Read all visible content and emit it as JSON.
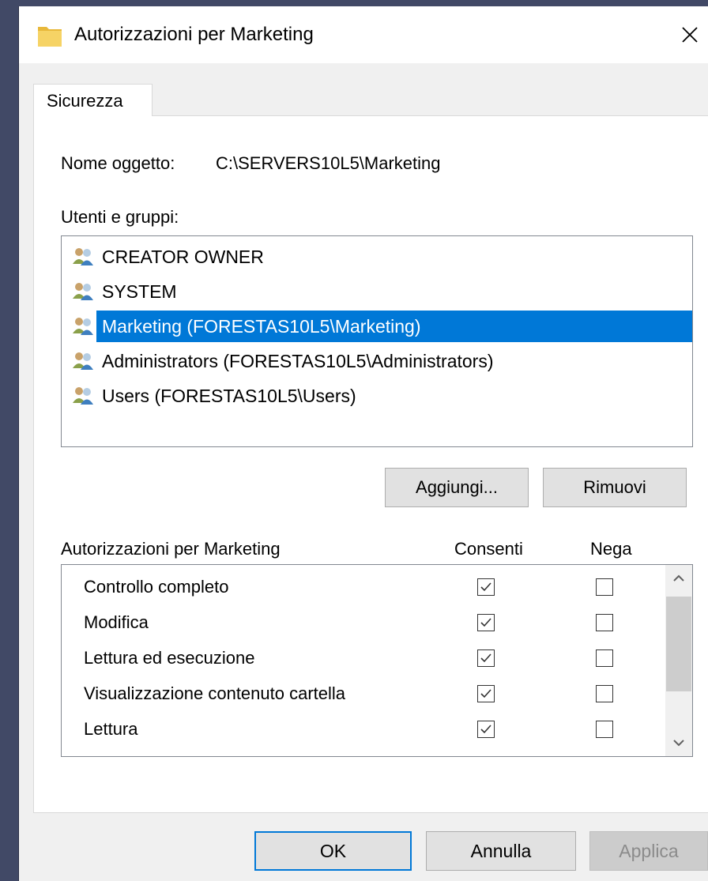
{
  "window": {
    "title": "Autorizzazioni per Marketing",
    "close_symbol": "✕"
  },
  "tabs": [
    {
      "label": "Sicurezza",
      "active": true
    }
  ],
  "object_name": {
    "label": "Nome oggetto:",
    "value": "C:\\SERVERS10L5\\Marketing"
  },
  "users": {
    "label": "Utenti e gruppi:",
    "items": [
      {
        "name": "CREATOR OWNER",
        "icon": "users-group-icon",
        "selected": false
      },
      {
        "name": "SYSTEM",
        "icon": "users-group-icon",
        "selected": false
      },
      {
        "name": "Marketing (FORESTAS10L5\\Marketing)",
        "icon": "users-group-icon",
        "selected": true
      },
      {
        "name": "Administrators (FORESTAS10L5\\Administrators)",
        "icon": "users-group-icon",
        "selected": false
      },
      {
        "name": "Users (FORESTAS10L5\\Users)",
        "icon": "users-group-icon",
        "selected": false
      }
    ],
    "add_label": "Aggiungi...",
    "remove_label": "Rimuovi"
  },
  "permissions": {
    "header": "Autorizzazioni per Marketing",
    "allow_header": "Consenti",
    "deny_header": "Nega",
    "rows": [
      {
        "label": "Controllo completo",
        "allow": true,
        "deny": false
      },
      {
        "label": "Modifica",
        "allow": true,
        "deny": false
      },
      {
        "label": "Lettura ed esecuzione",
        "allow": true,
        "deny": false
      },
      {
        "label": "Visualizzazione contenuto cartella",
        "allow": true,
        "deny": false
      },
      {
        "label": "Lettura",
        "allow": true,
        "deny": false
      }
    ]
  },
  "buttons": {
    "ok": "OK",
    "cancel": "Annulla",
    "apply": "Applica"
  },
  "colors": {
    "selection": "#0078d7",
    "desktop": "#414966",
    "dialog_bg": "#f0f0f0"
  }
}
